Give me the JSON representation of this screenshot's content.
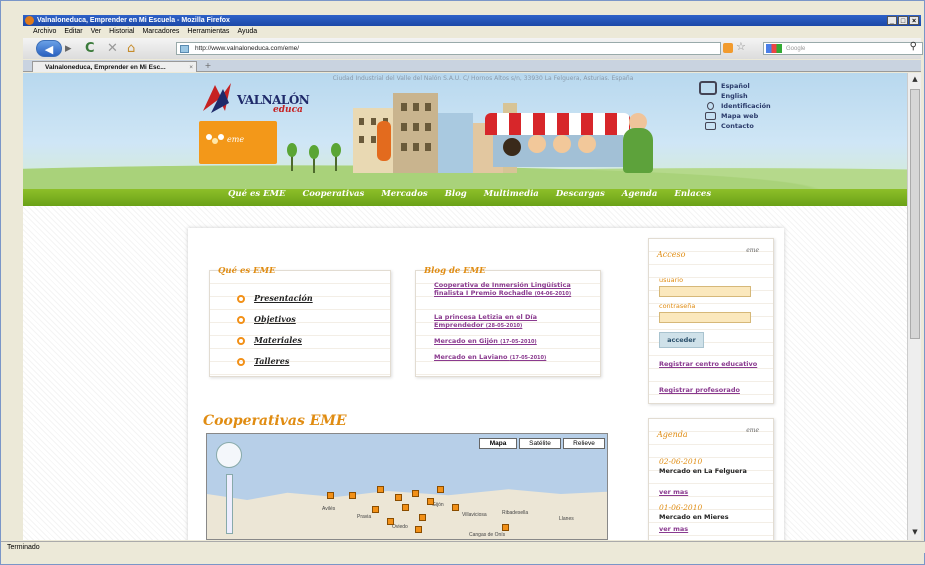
{
  "window": {
    "title": "Valnaloneduca, Emprender en Mi Escuela - Mozilla Firefox",
    "status": "Terminado"
  },
  "menu": [
    "Archivo",
    "Editar",
    "Ver",
    "Historial",
    "Marcadores",
    "Herramientas",
    "Ayuda"
  ],
  "navbar": {
    "url": "http://www.valnaloneduca.com/eme/",
    "search_placeholder": "Google"
  },
  "tab": {
    "label": "Valnaloneduca, Emprender en Mi Esc..."
  },
  "header": {
    "address": "Ciudad Industrial del Valle del Nalón S.A.U. C/ Hornos Altos s/n, 33930 La Felguera, Asturias. España",
    "brand": "VALNALÓN",
    "brand_sub": "educa",
    "badge_text": "eme",
    "util_links": [
      "Español",
      "English",
      "Identificación",
      "Mapa web",
      "Contacto"
    ]
  },
  "nav_menu": [
    "Qué es EME",
    "Cooperativas",
    "Mercados",
    "Blog",
    "Multimedia",
    "Descargas",
    "Agenda",
    "Enlaces"
  ],
  "que_es": {
    "title": "Qué es EME",
    "links": [
      "Presentación",
      "Objetivos",
      "Materiales",
      "Talleres"
    ]
  },
  "blog": {
    "title": "Blog de EME",
    "posts": [
      {
        "title": "Cooperativa de Inmersión Lingüística finalista I Premio Rochadle",
        "date": "(04-06-2010)"
      },
      {
        "title": "La princesa Letizia en el Día Emprendedor",
        "date": "(28-05-2010)"
      },
      {
        "title": "Mercado en Gijón",
        "date": "(17-05-2010)"
      },
      {
        "title": "Mercado en Laviano",
        "date": "(17-05-2010)"
      }
    ]
  },
  "acceso": {
    "title": "Acceso",
    "user_label": "usuario",
    "pass_label": "contraseña",
    "submit": "acceder",
    "link_centro": "Registrar centro educativo",
    "link_prof": "Registrar profesorado"
  },
  "agenda": {
    "title": "Agenda",
    "events": [
      {
        "date": "02-06-2010",
        "name": "Mercado en La Felguera",
        "more": "ver mas"
      },
      {
        "date": "01-06-2010",
        "name": "Mercado en Mieres",
        "more": "ver mas"
      }
    ]
  },
  "cooperativas": {
    "title": "Cooperativas EME",
    "map_types": [
      "Mapa",
      "Satélite",
      "Relieve"
    ],
    "places": [
      "Oviedo",
      "Gijón",
      "Avilés",
      "Pravia",
      "Cangas de Onís",
      "Llanes",
      "Ribadesella",
      "Villaviciosa"
    ]
  },
  "colors": {
    "accent_orange": "#f29017",
    "menu_green": "#7ab221",
    "link_purple": "#8a3a8f"
  }
}
